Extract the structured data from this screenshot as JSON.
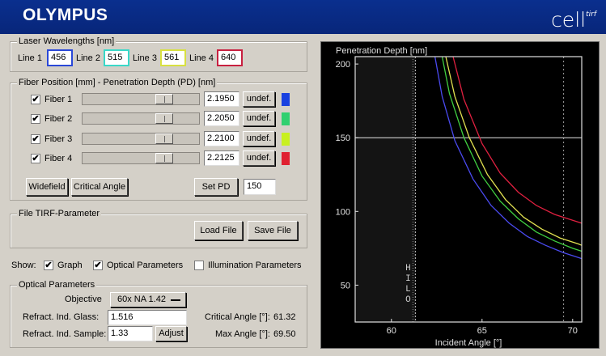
{
  "header": {
    "brand": "OLYMPUS",
    "product": "cell",
    "product_sup": "tirf"
  },
  "laser": {
    "title": "Laser Wavelengths [nm]",
    "lines": [
      {
        "label": "Line 1",
        "value": "456",
        "color": "#2a48d8"
      },
      {
        "label": "Line 2",
        "value": "515",
        "color": "#3ad8c8"
      },
      {
        "label": "Line 3",
        "value": "561",
        "color": "#d8e040"
      },
      {
        "label": "Line 4",
        "value": "640",
        "color": "#c82040"
      }
    ]
  },
  "fiber": {
    "title": "Fiber Position [mm] - Penetration Depth (PD) [nm]",
    "rows": [
      {
        "label": "Fiber 1",
        "checked": "✔",
        "position": "2.1950",
        "undef": "undef.",
        "color": "#1840e0"
      },
      {
        "label": "Fiber 2",
        "checked": "✔",
        "position": "2.2050",
        "undef": "undef.",
        "color": "#30d070"
      },
      {
        "label": "Fiber 3",
        "checked": "✔",
        "position": "2.2100",
        "undef": "undef.",
        "color": "#c8f020"
      },
      {
        "label": "Fiber 4",
        "checked": "✔",
        "position": "2.2125",
        "undef": "undef.",
        "color": "#e02030"
      }
    ],
    "widefield": "Widefield",
    "critical_angle": "Critical Angle",
    "set_pd": "Set PD",
    "pd_value": "150"
  },
  "file": {
    "title": "File TIRF-Parameter",
    "load": "Load File",
    "save": "Save File"
  },
  "show": {
    "label": "Show:",
    "graph": {
      "label": "Graph",
      "checked": "✔"
    },
    "optical": {
      "label": "Optical Parameters",
      "checked": "✔"
    },
    "illumination": {
      "label": "Illumination Parameters",
      "checked": ""
    }
  },
  "optical": {
    "title": "Optical Parameters",
    "objective_label": "Objective",
    "objective_value": "60x NA 1.42",
    "glass_label": "Refract. Ind. Glass:",
    "glass_value": "1.516",
    "sample_label": "Refract. Ind. Sample:",
    "sample_value": "1.33",
    "adjust": "Adjust",
    "critical_label": "Critical Angle [°]:",
    "critical_value": "61.32",
    "max_label": "Max Angle [°]:",
    "max_value": "69.50"
  },
  "chart_data": {
    "type": "line",
    "title": "Penetration Depth [nm]",
    "xlabel": "Incident Angle [°]",
    "ylabel": "",
    "xlim": [
      58,
      70.5
    ],
    "ylim": [
      25,
      205
    ],
    "xticks": [
      60,
      65,
      70
    ],
    "yticks": [
      50,
      100,
      150,
      200
    ],
    "hilo_label": "HILO",
    "critical_angle": 61.32,
    "max_angle": 69.5,
    "set_pd": 150,
    "series": [
      {
        "color": "#4a4af0",
        "x": [
          62.4,
          62.8,
          63.5,
          64.5,
          65.5,
          66.5,
          67.5,
          68.5,
          69.5,
          70.5
        ],
        "y": [
          205,
          178,
          148,
          122,
          104,
          92,
          83,
          77,
          72,
          68
        ]
      },
      {
        "color": "#40d040",
        "x": [
          62.8,
          63.2,
          64.0,
          65.0,
          66.0,
          67.0,
          68.0,
          69.0,
          70.0,
          70.5
        ],
        "y": [
          205,
          180,
          150,
          124,
          107,
          95,
          86,
          80,
          75,
          73
        ]
      },
      {
        "color": "#e0e050",
        "x": [
          63.0,
          63.5,
          64.3,
          65.3,
          66.3,
          67.3,
          68.3,
          69.3,
          70.3,
          70.5
        ],
        "y": [
          205,
          178,
          150,
          125,
          108,
          96,
          88,
          82,
          78,
          77
        ]
      },
      {
        "color": "#e02040",
        "x": [
          63.4,
          64.0,
          65.0,
          66.0,
          67.0,
          68.0,
          69.0,
          70.0,
          70.5
        ],
        "y": [
          205,
          176,
          146,
          126,
          113,
          104,
          98,
          94,
          92
        ]
      }
    ]
  }
}
